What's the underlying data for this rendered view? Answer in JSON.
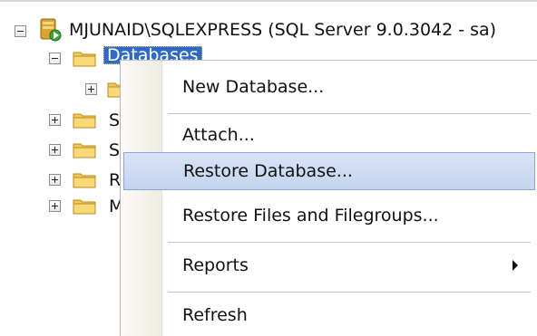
{
  "tree": {
    "server": {
      "label": "MJUNAID\\SQLEXPRESS (SQL Server 9.0.3042 - sa)",
      "expanded": true
    },
    "databases": {
      "label": "Databases",
      "expanded": true,
      "selected": true
    },
    "child_nodes": [
      {
        "label": "",
        "expanded": false
      },
      {
        "label": "S",
        "expanded": false
      },
      {
        "label": "S",
        "expanded": false
      },
      {
        "label": "R",
        "expanded": false
      },
      {
        "label": "M",
        "expanded": false
      }
    ]
  },
  "context_menu": {
    "items": [
      {
        "label": "New Database...",
        "highlighted": false
      },
      {
        "label": "Attach...",
        "highlighted": false
      },
      {
        "label": "Restore Database...",
        "highlighted": true
      },
      {
        "label": "Restore Files and Filegroups...",
        "highlighted": false
      },
      {
        "label": "Reports",
        "highlighted": false,
        "has_submenu": true
      },
      {
        "label": "Refresh",
        "highlighted": false
      }
    ]
  },
  "colors": {
    "selection": "#316ac5",
    "menu_highlight": "#c3d4ef",
    "folder": "#f2c85b"
  }
}
